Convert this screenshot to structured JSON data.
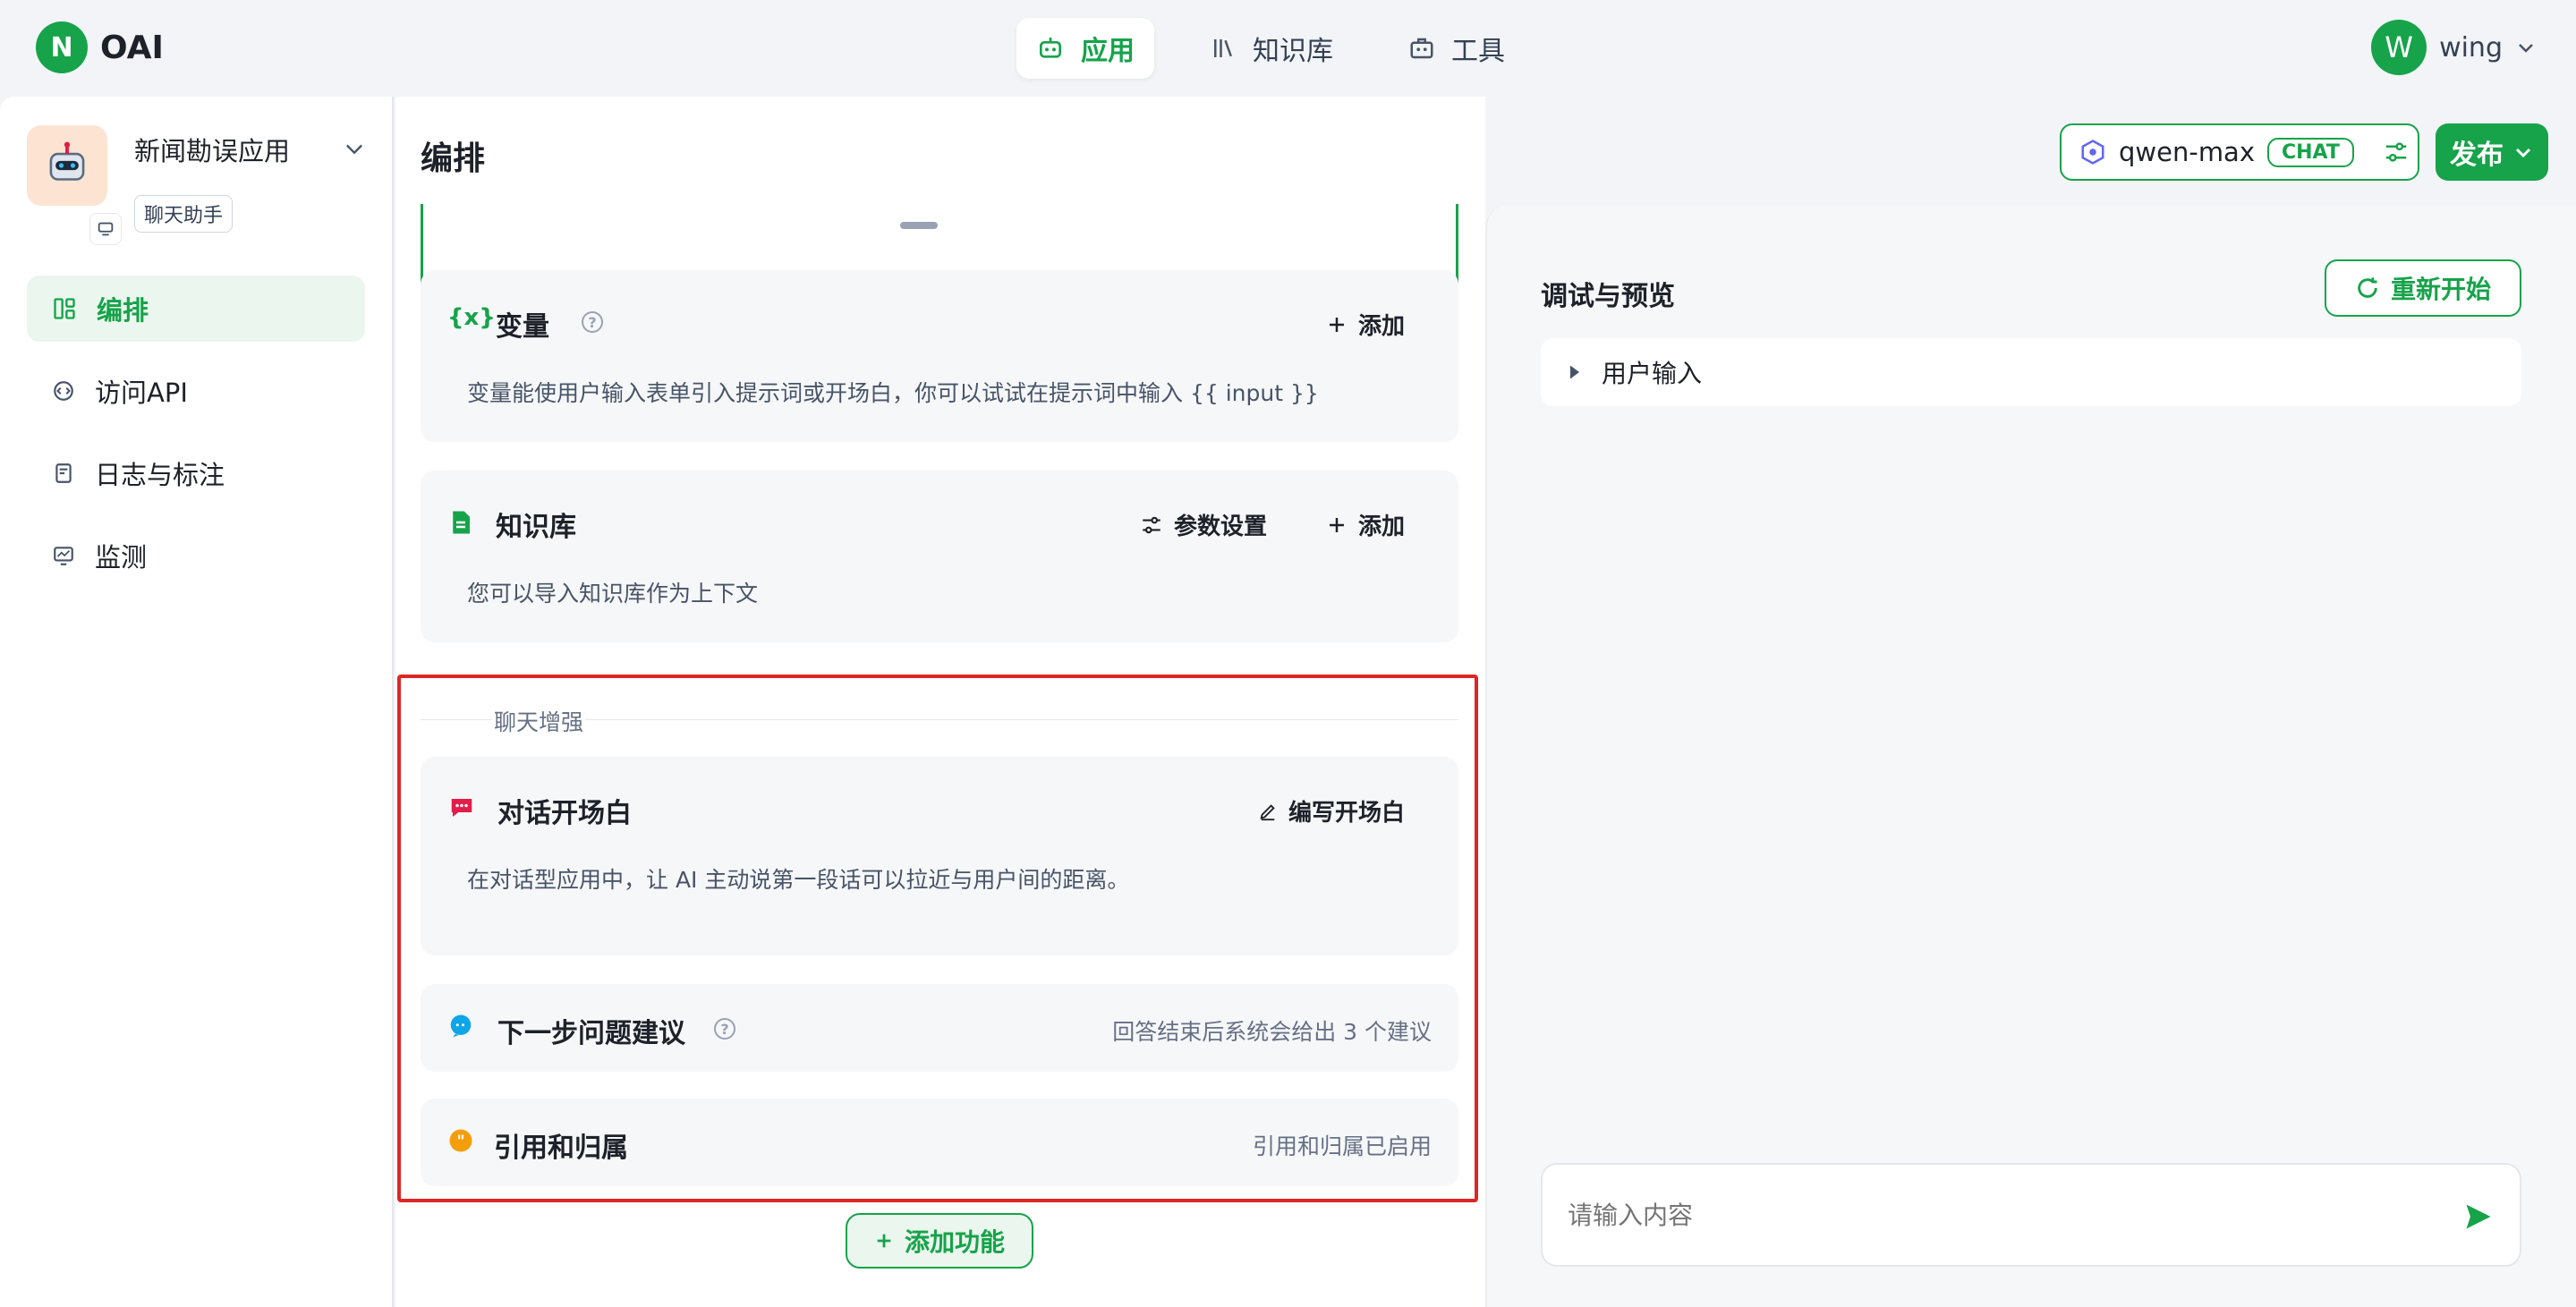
{
  "brand": {
    "name": "OAI"
  },
  "topnav": [
    {
      "label": "应用",
      "icon": "robot-icon",
      "active": true
    },
    {
      "label": "知识库",
      "icon": "books-icon",
      "active": false
    },
    {
      "label": "工具",
      "icon": "toolbox-icon",
      "active": false
    }
  ],
  "user": {
    "initial": "W",
    "name": "wing"
  },
  "app": {
    "name": "新闻勘误应用",
    "type": "聊天助手"
  },
  "sidenav": [
    {
      "label": "编排",
      "icon": "layout-icon",
      "active": true
    },
    {
      "label": "访问API",
      "icon": "api-icon",
      "active": false
    },
    {
      "label": "日志与标注",
      "icon": "log-icon",
      "active": false
    },
    {
      "label": "监测",
      "icon": "monitor-icon",
      "active": false
    }
  ],
  "editor": {
    "title": "编排",
    "variables": {
      "icon_text": "{x}",
      "title": "变量",
      "add": "添加",
      "desc": "变量能使用户输入表单引入提示词或开场白，你可以试试在提示词中输入 {{ input }}"
    },
    "knowledge": {
      "title": "知识库",
      "settings": "参数设置",
      "add": "添加",
      "desc": "您可以导入知识库作为上下文"
    },
    "enhance_label": "聊天增强",
    "opener": {
      "title": "对话开场白",
      "action": "编写开场白",
      "desc": "在对话型应用中，让 AI 主动说第一段话可以拉近与用户间的距离。"
    },
    "suggest": {
      "title": "下一步问题建议",
      "note": "回答结束后系统会给出 3 个建议"
    },
    "citation": {
      "title": "引用和归属",
      "note": "引用和归属已启用"
    },
    "add_feature": "添加功能"
  },
  "model": {
    "name": "qwen-max",
    "tag": "CHAT"
  },
  "publish_label": "发布",
  "preview": {
    "title": "调试与预览",
    "restart": "重新开始",
    "user_input": "用户输入",
    "placeholder": "请输入内容"
  },
  "colors": {
    "accent": "#16a34a",
    "highlight": "#dc2626"
  }
}
